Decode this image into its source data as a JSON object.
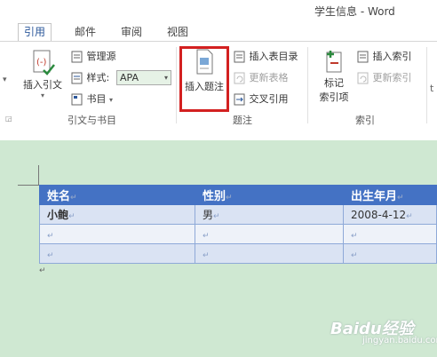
{
  "window": {
    "title": "学生信息 - Word"
  },
  "tabs": [
    {
      "label": "引用"
    },
    {
      "label": "邮件"
    },
    {
      "label": "审阅"
    },
    {
      "label": "视图"
    }
  ],
  "ribbon": {
    "citations": {
      "insert_citation": "插入引文",
      "manage_sources": "管理源",
      "style_label": "样式:",
      "style_value": "APA",
      "bibliography": "书目",
      "group_label": "引文与书目"
    },
    "captions": {
      "insert_caption": "插入题注",
      "insert_table_of_figures": "插入表目录",
      "update_table": "更新表格",
      "cross_reference": "交叉引用",
      "group_label": "题注"
    },
    "index": {
      "mark_entry_line1": "标记",
      "mark_entry_line2": "索引项",
      "insert_index": "插入索引",
      "update_index": "更新索引",
      "group_label": "索引"
    }
  },
  "table": {
    "headers": [
      "姓名",
      "性别",
      "出生年月"
    ],
    "rows": [
      [
        "小鲍",
        "男",
        "2008-4-12"
      ],
      [
        "",
        "",
        ""
      ],
      [
        "",
        "",
        ""
      ]
    ]
  },
  "watermark": {
    "main": "Baidu经验",
    "sub": "jingyan.baidu.com"
  },
  "colors": {
    "accent": "#2b579a",
    "header": "#4472c4",
    "highlight": "#d32020",
    "doc_bg": "#cfe8d2"
  }
}
